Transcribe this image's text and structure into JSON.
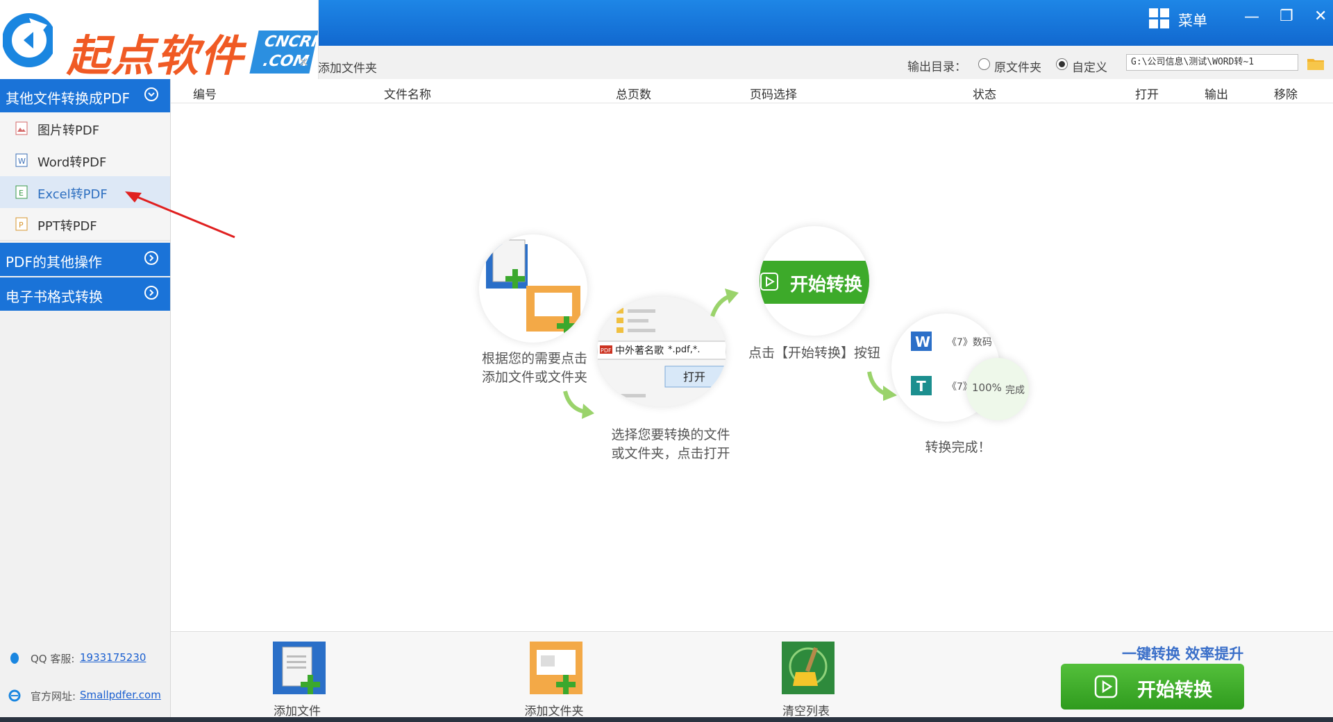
{
  "app": {
    "brand": "起点软件",
    "brand_badge_top": "CNCRK",
    "brand_badge_bottom": ".COM",
    "menu_label": "菜单",
    "minimize": "—",
    "restore": "❐",
    "close": "✕"
  },
  "toolbar": {
    "add_folder_partial": "添加文件夹",
    "output_dir_label": "输出目录：",
    "radio_original": "原文件夹",
    "radio_custom": "自定义",
    "selected_option": "自定义",
    "path_value": "G:\\公司信息\\测试\\WORD转~1"
  },
  "sidebar": {
    "categories": [
      {
        "label": "其他文件转换成PDF",
        "expanded": true
      },
      {
        "label": "PDF的其他操作",
        "expanded": false
      },
      {
        "label": "电子书格式转换",
        "expanded": false
      }
    ],
    "items": [
      {
        "label": "图片转PDF",
        "icon": "image-file-icon"
      },
      {
        "label": "Word转PDF",
        "icon": "word-file-icon"
      },
      {
        "label": "Excel转PDF",
        "icon": "excel-file-icon",
        "active": true
      },
      {
        "label": "PPT转PDF",
        "icon": "ppt-file-icon"
      }
    ],
    "qq_label": "QQ 客服:",
    "qq_value": "1933175230",
    "site_label": "官方网址:",
    "site_value": "Smallpdfer.com"
  },
  "table": {
    "columns": [
      "编号",
      "文件名称",
      "总页数",
      "页码选择",
      "状态",
      "打开",
      "输出",
      "移除"
    ]
  },
  "guide": {
    "step1": "根据您的需要点击\n添加文件或文件夹",
    "step2": "选择您要转换的文件\n或文件夹，点击打开",
    "step2_file": "中外著名歌",
    "step2_ext": "*.pdf,*.",
    "step2_open": "打开",
    "step3": "点击【开始转换】按钮",
    "step3_btn": "开始转换",
    "step4": "转换完成！",
    "step4_row1": "《7》数码",
    "step4_row2": "《7》",
    "step4_pct": "100%",
    "step4_done": "完成"
  },
  "bottom": {
    "add_file": "添加文件",
    "add_folder": "添加文件夹",
    "clear_list": "清空列表",
    "slogan": "一键转换  效率提升",
    "start": "开始转换"
  },
  "colors": {
    "title_blue": "#1168cf",
    "sidebar_blue": "#1a73d8",
    "start_green": "#2f9b1e",
    "brand_orange": "#f05a24"
  }
}
